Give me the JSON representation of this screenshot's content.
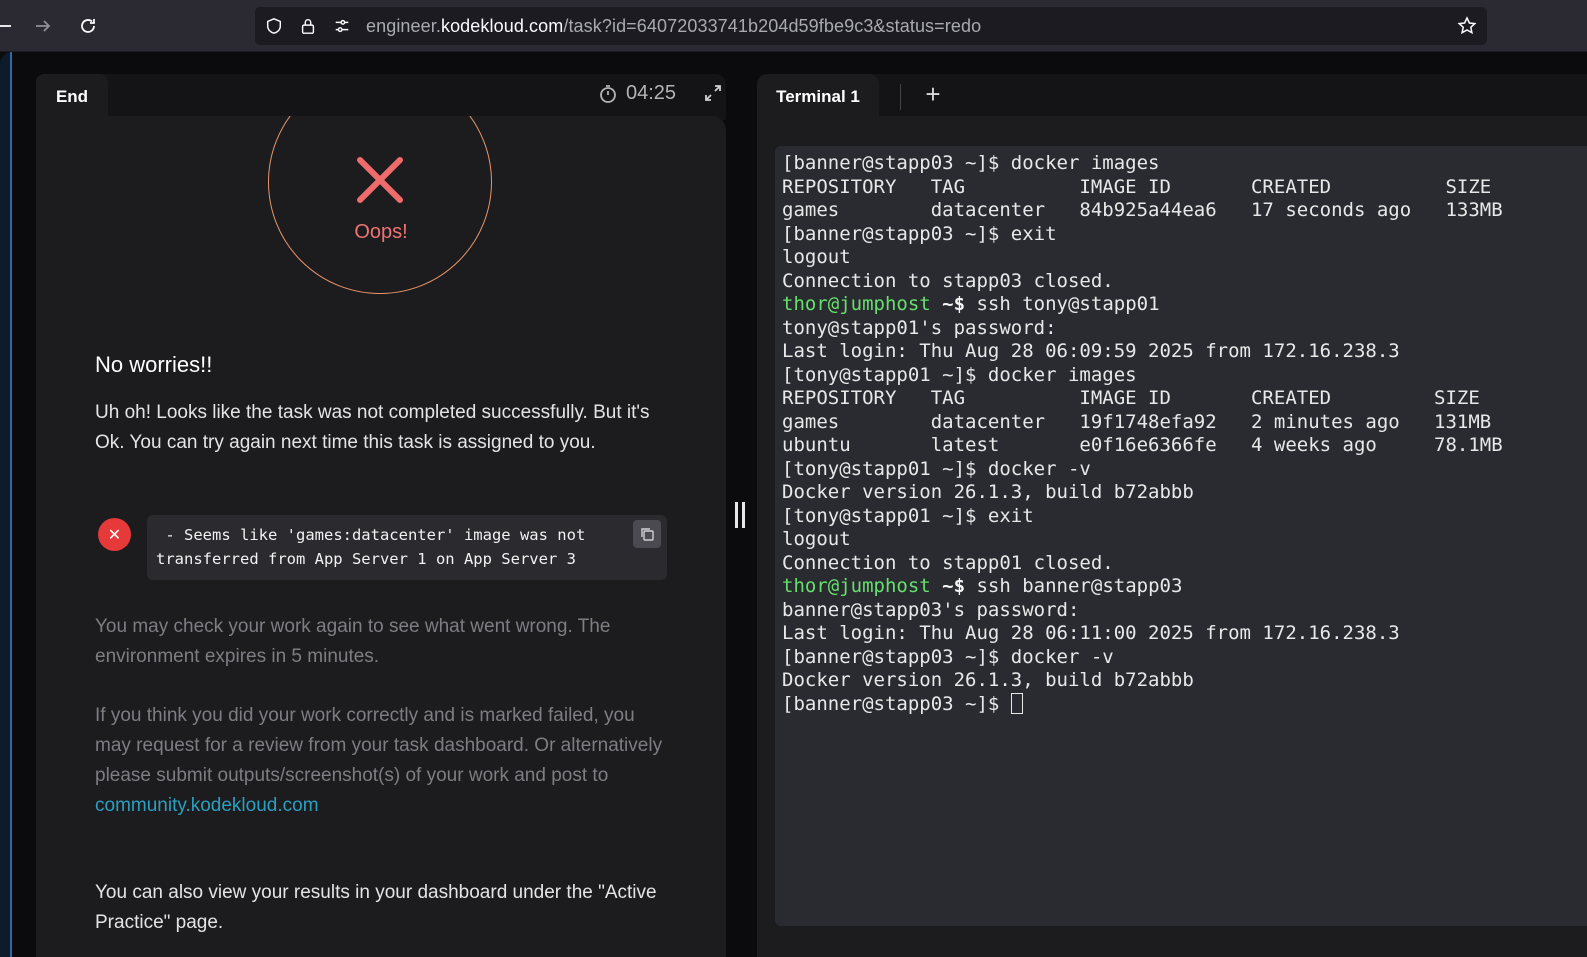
{
  "browser": {
    "url_prefix": "engineer.",
    "url_host": "kodekloud.com",
    "url_path": "/task?id=64072033741b204d59fbe9c3&status=redo"
  },
  "left": {
    "tab_label": "End",
    "timer": "04:25",
    "oops": "Oops!",
    "heading": "No worries!!",
    "message": "Uh oh! Looks like the task was not completed successfully. But it's Ok. You can try again next time this task is assigned to you.",
    "error": " - Seems like 'games:datacenter' image was not transferred from App Server 1 on App Server 3",
    "check_msg": "You may check your work again to see what went wrong. The environment expires in 5 minutes.",
    "review_msg": "If you think you did your work correctly and is marked failed, you may request for a review from your task dashboard. Or alternatively please submit outputs/screenshot(s) of your work and post to ",
    "community_link": "community.kodekloud.com",
    "dashboard_msg": "You can also view your results in your dashboard under the \"Active Practice\" page."
  },
  "right": {
    "tab_label": "Terminal 1",
    "add_tab": "+",
    "terminal_lines": [
      {
        "text": "[banner@stapp03 ~]$ docker images"
      },
      {
        "text": "REPOSITORY   TAG          IMAGE ID       CREATED          SIZE"
      },
      {
        "text": "games        datacenter   84b925a44ea6   17 seconds ago   133MB"
      },
      {
        "text": "[banner@stapp03 ~]$ exit"
      },
      {
        "text": "logout"
      },
      {
        "text": "Connection to stapp03 closed."
      },
      {
        "host": "thor@jumphost",
        "prompt": " ~$",
        "text": " ssh tony@stapp01"
      },
      {
        "text": "tony@stapp01's password:"
      },
      {
        "text": "Last login: Thu Aug 28 06:09:59 2025 from 172.16.238.3"
      },
      {
        "text": "[tony@stapp01 ~]$ docker images"
      },
      {
        "text": "REPOSITORY   TAG          IMAGE ID       CREATED         SIZE"
      },
      {
        "text": "games        datacenter   19f1748efa92   2 minutes ago   131MB"
      },
      {
        "text": "ubuntu       latest       e0f16e6366fe   4 weeks ago     78.1MB"
      },
      {
        "text": "[tony@stapp01 ~]$ docker -v"
      },
      {
        "text": "Docker version 26.1.3, build b72abbb"
      },
      {
        "text": "[tony@stapp01 ~]$ exit"
      },
      {
        "text": "logout"
      },
      {
        "text": "Connection to stapp01 closed."
      },
      {
        "host": "thor@jumphost",
        "prompt": " ~$",
        "text": " ssh banner@stapp03"
      },
      {
        "text": "banner@stapp03's password:"
      },
      {
        "text": "Last login: Thu Aug 28 06:11:00 2025 from 172.16.238.3"
      },
      {
        "text": "[banner@stapp03 ~]$ docker -v"
      },
      {
        "text": "Docker version 26.1.3, build b72abbb"
      },
      {
        "text": "[banner@stapp03 ~]$ ",
        "cursor": true
      }
    ]
  },
  "colors": {
    "prompt_green": "#66e06c",
    "error_red": "#e63a3a",
    "oops_red": "#f07272",
    "link": "#2b9fbf"
  }
}
